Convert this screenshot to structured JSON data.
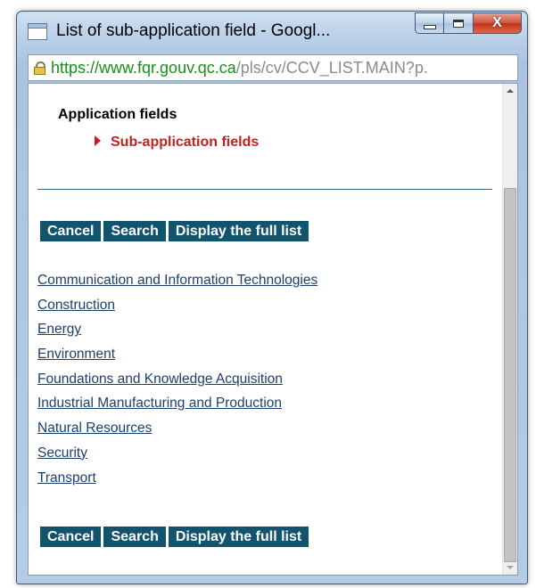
{
  "window": {
    "title": "List of sub-application field - Googl...",
    "controls": {
      "close": "X"
    }
  },
  "address": {
    "secure_part": "https://www.fqr.gouv.qc.ca",
    "path_part": "/pls/cv/CCV_LIST.MAIN?p."
  },
  "breadcrumb": {
    "title": "Application fields",
    "current": "Sub-application fields"
  },
  "buttons": {
    "cancel": "Cancel",
    "search": "Search",
    "display_full": "Display the full list"
  },
  "links": [
    "Communication and Information Technologies",
    "Construction",
    "Energy",
    "Environment",
    "Foundations and Knowledge Acquisition",
    "Industrial Manufacturing and Production",
    "Natural Resources",
    "Security",
    "Transport"
  ],
  "colors": {
    "button_bg": "#12536e",
    "accent_red": "#c71f1f",
    "link": "#1c3f6e"
  }
}
